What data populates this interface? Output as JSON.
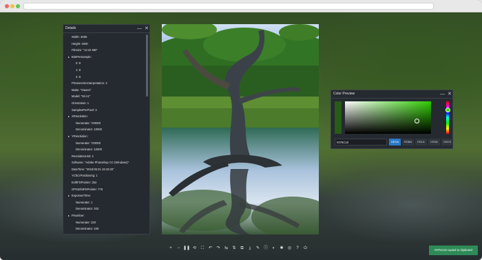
{
  "details": {
    "title": "Details",
    "minimize": "—",
    "close": "✕",
    "rows": [
      {
        "level": 0,
        "bullet": "",
        "text": "Width: 3000"
      },
      {
        "level": 0,
        "bullet": "",
        "text": "Height: 4000"
      },
      {
        "level": 0,
        "bullet": "",
        "text": "Filesize: \"13.22 MB\""
      },
      {
        "level": 1,
        "bullet": "▸",
        "text": "BitsPerSample:"
      },
      {
        "level": 2,
        "bullet": "",
        "text": "0: 8"
      },
      {
        "level": 2,
        "bullet": "",
        "text": "1: 8"
      },
      {
        "level": 2,
        "bullet": "",
        "text": "2: 8"
      },
      {
        "level": 0,
        "bullet": "",
        "text": "PhotometricInterpretation: 2"
      },
      {
        "level": 0,
        "bullet": "",
        "text": "Make: \"Xiaomi\""
      },
      {
        "level": 0,
        "bullet": "",
        "text": "Model: \"Mi A1\""
      },
      {
        "level": 0,
        "bullet": "",
        "text": "Orientation: 1"
      },
      {
        "level": 0,
        "bullet": "",
        "text": "SamplesPerPixel: 3"
      },
      {
        "level": 1,
        "bullet": "▸",
        "text": "XResolution:"
      },
      {
        "level": 2,
        "bullet": "",
        "text": "Numerator: 720000"
      },
      {
        "level": 2,
        "bullet": "",
        "text": "Denominator: 10000"
      },
      {
        "level": 1,
        "bullet": "▸",
        "text": "YResolution:"
      },
      {
        "level": 2,
        "bullet": "",
        "text": "Numerator: 720000"
      },
      {
        "level": 2,
        "bullet": "",
        "text": "Denominator: 10000"
      },
      {
        "level": 0,
        "bullet": "",
        "text": "ResolutionUnit: 2"
      },
      {
        "level": 0,
        "bullet": "",
        "text": "Software: \"Adobe Photoshop CC (Windows)\""
      },
      {
        "level": 0,
        "bullet": "",
        "text": "DateTime: \"2018:05:31 19:43:20\""
      },
      {
        "level": 0,
        "bullet": "",
        "text": "YCbCrPositioning: 1"
      },
      {
        "level": 0,
        "bullet": "",
        "text": "ExifIFDPointer: 252"
      },
      {
        "level": 0,
        "bullet": "",
        "text": "GPSInfoIFDPointer: 776"
      },
      {
        "level": 1,
        "bullet": "▸",
        "text": "ExposureTime:"
      },
      {
        "level": 2,
        "bullet": "",
        "text": "Numerator: 1"
      },
      {
        "level": 2,
        "bullet": "",
        "text": "Denominator: 202"
      },
      {
        "level": 1,
        "bullet": "▸",
        "text": "FNumber:"
      },
      {
        "level": 2,
        "bullet": "",
        "text": "Numerator: 220"
      },
      {
        "level": 2,
        "bullet": "",
        "text": "Denominator: 100"
      }
    ]
  },
  "color_preview": {
    "title": "Color Preview",
    "minimize": "—",
    "close": "✕",
    "swatch_color": "#275c18",
    "hex_value": "#275C18",
    "formats": [
      "HEXA",
      "RGBA",
      "HSLA",
      "HSVA",
      "CMYK"
    ],
    "active_format": "HEXA"
  },
  "toolbar": {
    "icons": [
      {
        "name": "zoom-in-icon",
        "glyph": "+"
      },
      {
        "name": "zoom-out-icon",
        "glyph": "−"
      },
      {
        "name": "pause-icon",
        "glyph": "❚❚"
      },
      {
        "name": "reset-icon",
        "glyph": "⟲"
      },
      {
        "name": "fullscreen-icon",
        "glyph": "⛶"
      },
      {
        "name": "undo-icon",
        "glyph": "↶"
      },
      {
        "name": "redo-icon",
        "glyph": "↷"
      },
      {
        "name": "flip-horizontal-icon",
        "glyph": "⇆"
      },
      {
        "name": "flip-vertical-icon",
        "glyph": "⇅"
      },
      {
        "name": "crop-icon",
        "glyph": "⧉"
      },
      {
        "name": "download-icon",
        "glyph": "⤓"
      },
      {
        "name": "eyedropper-icon",
        "glyph": "✎"
      },
      {
        "name": "info-icon",
        "glyph": "ⓘ"
      },
      {
        "name": "palette-icon",
        "glyph": "◐"
      },
      {
        "name": "settings-icon",
        "glyph": "✱"
      },
      {
        "name": "globe-icon",
        "glyph": "◎"
      },
      {
        "name": "help-icon",
        "glyph": "?"
      },
      {
        "name": "power-icon",
        "glyph": "⏻"
      }
    ]
  },
  "toast": {
    "message": "#275C18 copied to clipboard",
    "color": "#2e8b57"
  }
}
